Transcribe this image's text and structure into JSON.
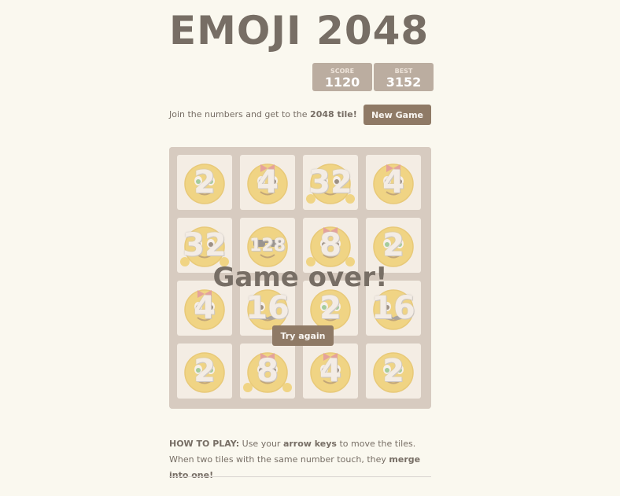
{
  "header": {
    "title": "EMOJI 2048"
  },
  "scores": {
    "score_label": "SCORE",
    "score_value": "1120",
    "best_label": "BEST",
    "best_value": "3152"
  },
  "intro": {
    "prefix": "Join the numbers and get to the ",
    "bold": "2048 tile!"
  },
  "buttons": {
    "new_game": "New Game",
    "try_again": "Try again"
  },
  "board": {
    "rows": [
      [
        "2",
        "4",
        "32",
        "4"
      ],
      [
        "32",
        "128",
        "8",
        "2"
      ],
      [
        "4",
        "16",
        "2",
        "16"
      ],
      [
        "2",
        "8",
        "4",
        "2"
      ]
    ],
    "tile_icons": {
      "2": "emoji-face-green-eyes-icon",
      "4": "emoji-face-red-bow-icon",
      "8": "emoji-face-bow-hands-icon",
      "16": "emoji-face-mustache-icon",
      "32": "emoji-face-hands-icon",
      "128": "emoji-face-sunglasses-icon"
    }
  },
  "overlay": {
    "message": "Game over!"
  },
  "howto": {
    "label": "HOW TO PLAY:",
    "t1": " Use your ",
    "b1": "arrow keys",
    "t2": " to move the tiles. When two tiles with the same number touch, they ",
    "b2": "merge into one!"
  },
  "colors": {
    "board": "#bbada0",
    "button": "#8f7a66",
    "background": "#faf8ef",
    "emoji_yellow": "#f2c21c"
  }
}
